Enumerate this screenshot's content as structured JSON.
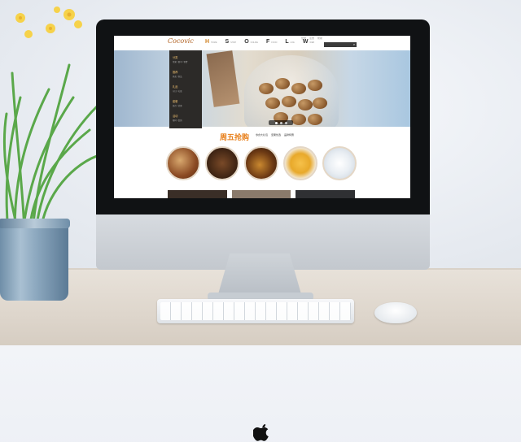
{
  "scene": {
    "accent": "#e8801c",
    "monitor_bezel": "#101214",
    "apple_logo": "apple-logo-icon"
  },
  "site": {
    "logo": "Cocovic",
    "nav": [
      {
        "key": "H",
        "label": "H",
        "sub": "HOME"
      },
      {
        "key": "S",
        "label": "S",
        "sub": "SHOP"
      },
      {
        "key": "O",
        "label": "O",
        "sub": "ONLINE"
      },
      {
        "key": "F",
        "label": "F",
        "sub": "FOOD"
      },
      {
        "key": "L",
        "label": "L",
        "sub": "LIFE"
      },
      {
        "key": "W",
        "label": "W",
        "sub": "WEB"
      }
    ],
    "top_links": [
      "登录",
      "注册",
      "帮助"
    ],
    "search": {
      "placeholder": ""
    },
    "side_menu": [
      {
        "cat": "分类",
        "sub": "坚果 / 果干 / 零食"
      },
      {
        "cat": "推荐",
        "sub": "热卖 / 新品"
      },
      {
        "cat": "礼品",
        "sub": "节日 / 礼盒"
      },
      {
        "cat": "套餐",
        "sub": "组合 / 优惠"
      },
      {
        "cat": "活动",
        "sub": "限时 / 促销"
      }
    ],
    "section": {
      "title": "周五抢购",
      "tags": [
        "零食大礼包",
        "坚果优选",
        "品牌特惠"
      ],
      "sub": ""
    }
  }
}
